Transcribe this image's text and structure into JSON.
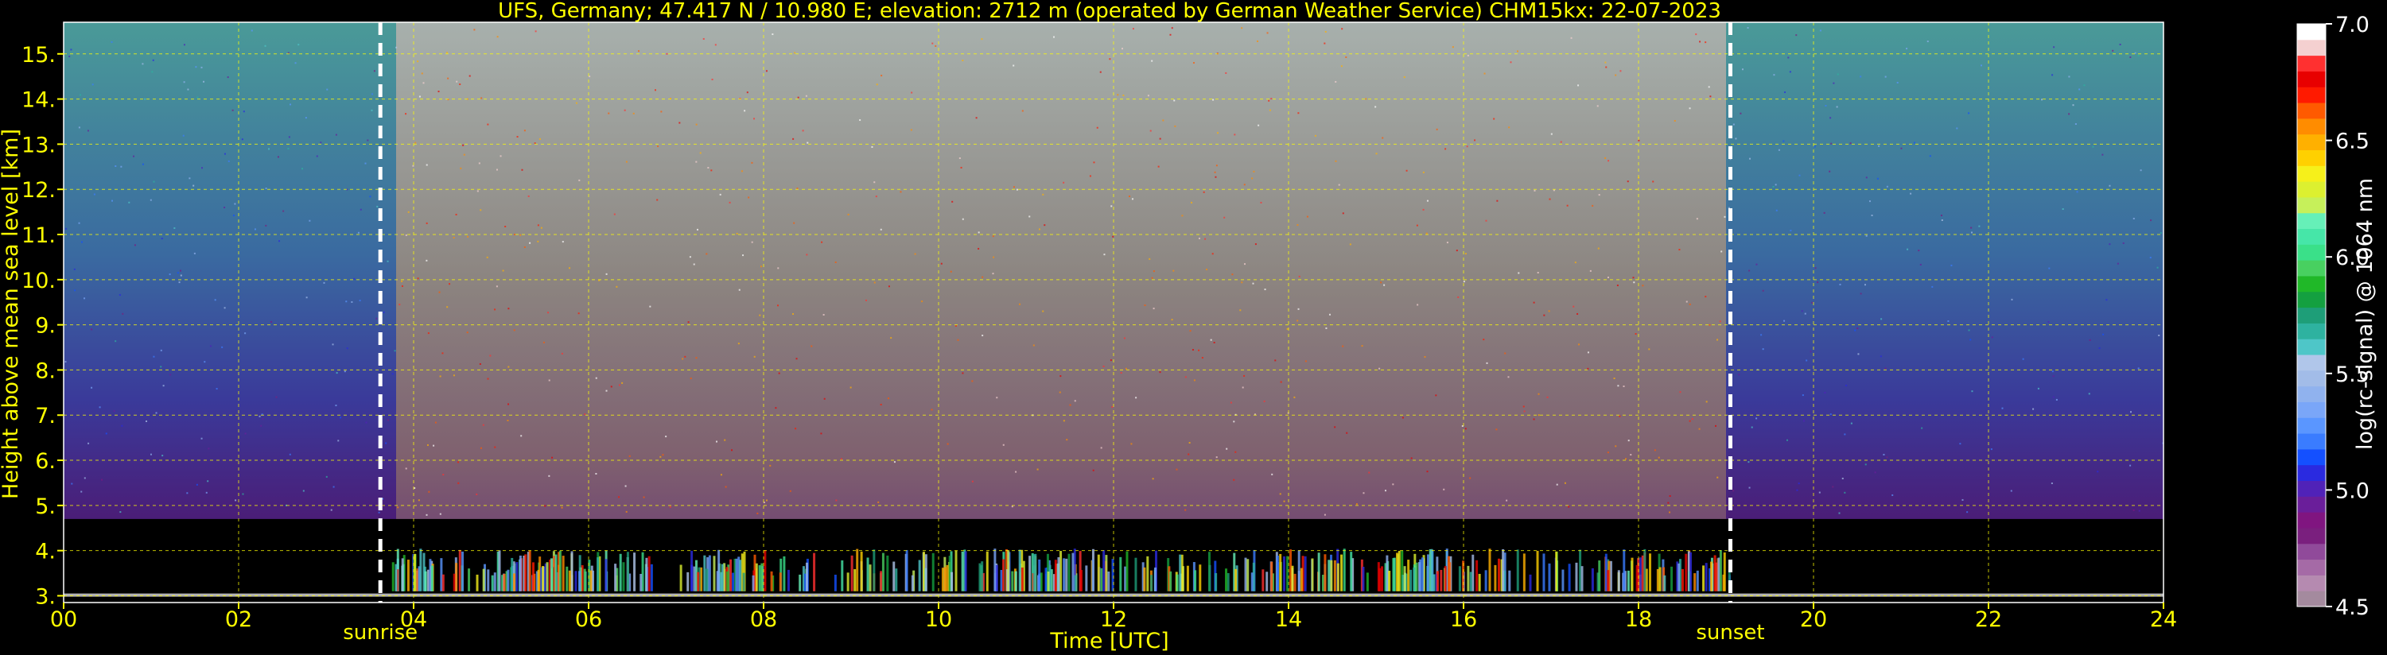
{
  "chart_data": {
    "type": "heatmap",
    "title": "UFS, Germany; 47.417 N / 10.980 E; elevation: 2712 m  (operated by German Weather Service)    CHM15kx: 22-07-2023",
    "xlabel": "Time [UTC]",
    "ylabel": "Height above mean sea level [km]",
    "xlim": [
      0,
      24
    ],
    "ylim": [
      2.85,
      15.7
    ],
    "x_ticks": [
      "00",
      "02",
      "04",
      "06",
      "08",
      "10",
      "12",
      "14",
      "16",
      "18",
      "20",
      "22",
      "24"
    ],
    "y_ticks": [
      "3.",
      "4.",
      "5.",
      "6.",
      "7.",
      "8.",
      "9.",
      "10.",
      "11.",
      "12.",
      "13.",
      "14.",
      "15."
    ],
    "grid": true,
    "colorbar": {
      "label": "log(rc-signal) @ 1064 nm",
      "range": [
        4.5,
        7.0
      ],
      "ticks": [
        "7.0",
        "6.5",
        "6.0",
        "5.5",
        "5.0",
        "4.5"
      ],
      "colors": [
        "#a48a9e",
        "#b58ab0",
        "#a56aa6",
        "#904a9a",
        "#7a1f7e",
        "#801580",
        "#6a1e9a",
        "#5022b8",
        "#2a2ae0",
        "#1450ff",
        "#3a7cff",
        "#5a96ff",
        "#7aa6f8",
        "#90b2ee",
        "#a2bce8",
        "#b0c6ea",
        "#4ec6c8",
        "#2eb2a0",
        "#1e9e78",
        "#14a040",
        "#20b828",
        "#48d060",
        "#3ae089",
        "#46e6a8",
        "#66f0b8",
        "#c6f05a",
        "#dcf030",
        "#f6f01a",
        "#ffd000",
        "#ffb000",
        "#ff8c00",
        "#ff5a00",
        "#ff1a00",
        "#e80000",
        "#ff3030",
        "#f4d0d0",
        "#ffffff"
      ]
    },
    "annotations": [
      {
        "text": "sunrise",
        "x": 3.62
      },
      {
        "text": "sunset",
        "x": 19.05
      }
    ]
  }
}
